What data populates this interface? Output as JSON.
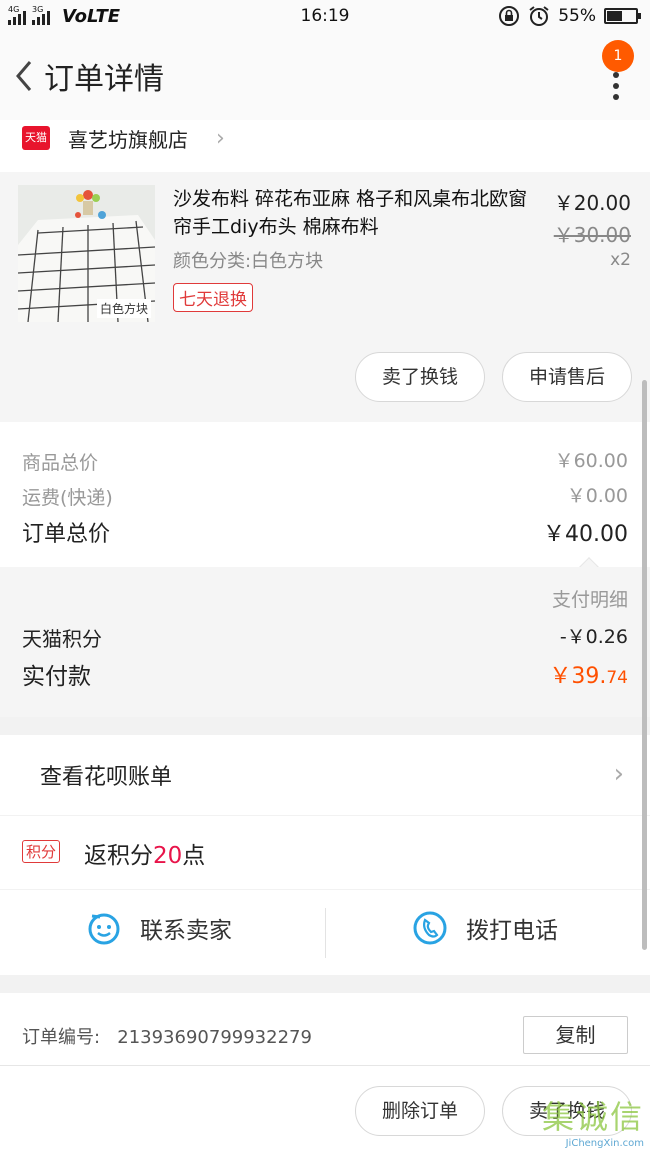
{
  "status_bar": {
    "net_left": "4G",
    "net_right": "3G",
    "volte": "VoLTE",
    "time": "16:19",
    "battery": "55%",
    "battery_level": 0.55
  },
  "header": {
    "title": "订单详情",
    "notif_count": "1"
  },
  "store": {
    "badge": "天猫",
    "name": "喜艺坊旗舰店"
  },
  "product": {
    "title": "沙发布料 碎花布亚麻 格子和风桌布北欧窗帘手工diy布头 棉麻布料",
    "price": "￥20.00",
    "original_price": "￥30.00",
    "qty": "x2",
    "variant": "颜色分类:白色方块",
    "image_label": "白色方块",
    "return_tag": "七天退换",
    "actions": [
      "卖了换钱",
      "申请售后"
    ]
  },
  "summary": {
    "goods_total_label": "商品总价",
    "goods_total": "￥60.00",
    "shipping_label": "运费(快递)",
    "shipping": "￥0.00",
    "order_total_label": "订单总价",
    "order_total": "￥40.00"
  },
  "payment": {
    "detail_link": "支付明细",
    "points_label": "天猫积分",
    "points_value": "-￥0.26",
    "paid_label": "实付款",
    "paid_main": "￥39.",
    "paid_decimal": "74"
  },
  "huabei": {
    "label": "查看花呗账单"
  },
  "points_reward": {
    "tag": "积分",
    "prefix": "返积分",
    "amount": "20",
    "suffix": "点"
  },
  "contact": {
    "seller": "联系卖家",
    "phone": "拨打电话"
  },
  "order_info": {
    "number_label": "订单编号:",
    "number": "21393690799932279",
    "copy": "复制"
  },
  "bottom_bar": {
    "delete": "删除订单",
    "resell": "卖了换钱"
  },
  "watermark": {
    "text": "JiChengXin.com",
    "cn": "集诚信"
  }
}
